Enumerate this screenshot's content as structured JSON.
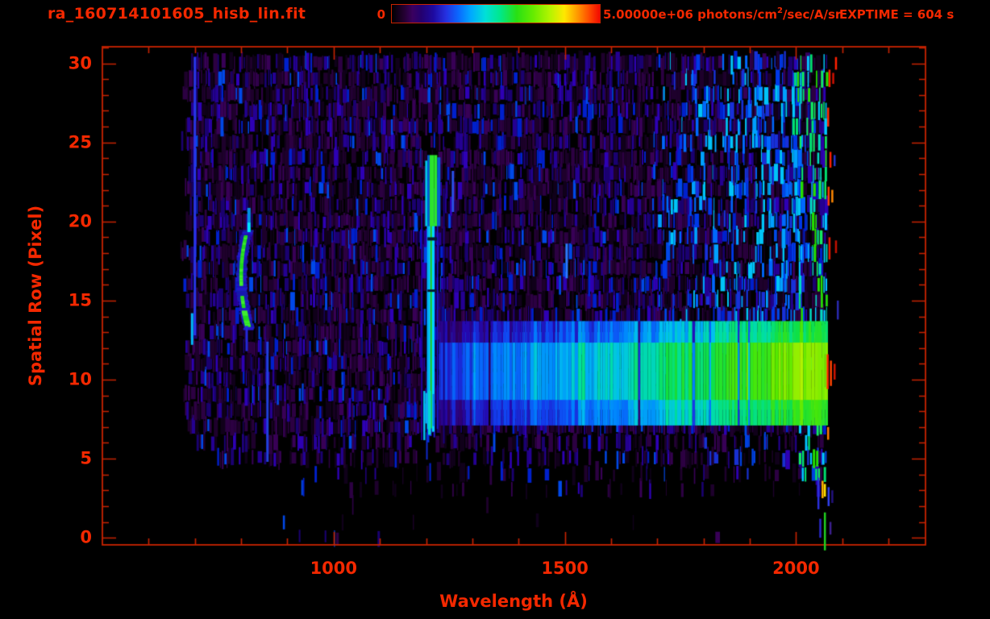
{
  "header": {
    "title": "ra_160714101605_hisb_lin.fit",
    "colorbar": {
      "min_label": "0",
      "max_value": "5.00000e+06",
      "unit_pre": " photons/cm",
      "unit_sup": "2",
      "unit_post": "/sec/A/sr"
    },
    "exptime_label": "EXPTIME = 604 s"
  },
  "colors": {
    "background": "#000000",
    "text_red": "#f32800",
    "axis_red": "#c82300",
    "colormap_stops": [
      "#000000 0%",
      "#240032 6%",
      "#3a0060 10%",
      "#24006e 14%",
      "#1e0aa0 20%",
      "#2530e0 26%",
      "#0a68ff 32%",
      "#00a8ff 38%",
      "#00e0d8 45%",
      "#00e88c 52%",
      "#28e014 60%",
      "#66ec00 68%",
      "#b4f400 76%",
      "#ffe800 83%",
      "#ff9c00 89%",
      "#ff4a00 95%",
      "#f20800 100%"
    ]
  },
  "chart_data": {
    "type": "heatmap",
    "title": "ra_160714101605_hisb_lin.fit",
    "xlabel": "Wavelength (Å)",
    "ylabel": "Spatial Row (Pixel)",
    "xlim": [
      500,
      2280
    ],
    "ylim": [
      -0.45,
      31.05
    ],
    "x_major_ticks": [
      1000,
      1500,
      2000
    ],
    "x_minor_tick_step": 100,
    "x_minor_tick_range": [
      600,
      2200
    ],
    "y_major_ticks": [
      0,
      5,
      10,
      15,
      20,
      25,
      30
    ],
    "y_minor_tick_step": 1,
    "colorbar": {
      "min": 0,
      "max": 5000000,
      "units": "photons/cm^2/sec/A/sr"
    },
    "exposure_time_s": 604,
    "data_wavelength_range": [
      668,
      2072
    ],
    "features": [
      {
        "name": "lyman-alpha-emission-line",
        "type": "vertical-line",
        "wavelength_center": 1208,
        "wavelength_halo": [
          1186,
          1246
        ],
        "rows": [
          5,
          24.3
        ],
        "bright_blob_rows": [
          19.8,
          24.2
        ],
        "narrow_core_rows": [
          7.4,
          19.6
        ],
        "cyan_blob_rows": [
          6.3,
          9
        ]
      },
      {
        "name": "continuum-band",
        "type": "horizontal-band",
        "rows": [
          7.6,
          13.2
        ],
        "wavelength": [
          1228,
          2068
        ],
        "color_ramp": "blue-cyan-green-yellow",
        "peak_rows": [
          8.6,
          12.5
        ]
      },
      {
        "name": "arc-feature",
        "type": "curved-line",
        "wavelength": [
          795,
          826
        ],
        "rows": [
          13.3,
          19.4
        ],
        "green_segments": [
          [
            16.0,
            19.1
          ],
          [
            14.6,
            15.3
          ],
          [
            13.4,
            14.3
          ]
        ]
      },
      {
        "name": "detector-right-edge",
        "type": "bright-edge",
        "wavelength": [
          1992,
          2066
        ],
        "rows": [
          4,
          30.5
        ]
      },
      {
        "name": "upper-right-blue-enhancement",
        "rows": [
          13,
          30.5
        ],
        "wavelength": [
          1700,
          2012
        ]
      },
      {
        "name": "blue-streaks",
        "streaks": [
          {
            "l": 700,
            "rows": [
              12.8,
              30.4
            ],
            "c": "#2836e8"
          },
          {
            "l": 694,
            "rows": [
              12.2,
              14.2
            ],
            "c": "#00b8f8"
          },
          {
            "l": 857,
            "rows": [
              4.8,
              12.4
            ],
            "c": "#2040dd"
          },
          {
            "l": 812,
            "rows": [
              11.8,
              13.4
            ],
            "c": "#2228d8"
          },
          {
            "l": 1504,
            "rows": [
              16.4,
              18.6
            ],
            "c": "#2a7cff"
          },
          {
            "l": 1258,
            "rows": [
              20.6,
              23.2
            ],
            "c": "#2a50e8"
          }
        ]
      },
      {
        "name": "edge-sparks",
        "sparks": [
          {
            "l": 2072,
            "r": [
              28.5,
              29.6
            ],
            "c": "#ff1e00"
          },
          {
            "l": 2080,
            "r": [
              28.7,
              29.4
            ],
            "c": "#d01000"
          },
          {
            "l": 2086,
            "r": [
              29.6,
              30.4
            ],
            "c": "#ff2000"
          },
          {
            "l": 2069,
            "r": [
              26.0,
              27.2
            ],
            "c": "#ff2a00"
          },
          {
            "l": 2074,
            "r": [
              23.4,
              24.4
            ],
            "c": "#ff2000"
          },
          {
            "l": 2083,
            "r": [
              23.5,
              24.2
            ],
            "c": "#2233cc"
          },
          {
            "l": 2070,
            "r": [
              21.0,
              22.2
            ],
            "c": "#ff3c00"
          },
          {
            "l": 2078,
            "r": [
              21.2,
              22.0
            ],
            "c": "#ff8800"
          },
          {
            "l": 2072,
            "r": [
              17.6,
              19.0
            ],
            "c": "#e81800"
          },
          {
            "l": 2086,
            "r": [
              18.0,
              18.8
            ],
            "c": "#c01000"
          },
          {
            "l": 2090,
            "r": [
              13.8,
              15.0
            ],
            "c": "#2a2ab0"
          },
          {
            "l": 2068,
            "r": [
              9.4,
              11.6
            ],
            "c": "#ff2400"
          },
          {
            "l": 2075,
            "r": [
              9.6,
              11.2
            ],
            "c": "#ff4400"
          },
          {
            "l": 2083,
            "r": [
              10.0,
              11.0
            ],
            "c": "#cc1400"
          },
          {
            "l": 2069,
            "r": [
              6.2,
              7.0
            ],
            "c": "#ff7a00"
          },
          {
            "l": 2057,
            "r": [
              2.5,
              3.6
            ],
            "c": "#ffb400"
          },
          {
            "l": 2062,
            "r": [
              2.6,
              3.4
            ],
            "c": "#ffe000"
          },
          {
            "l": 2048,
            "r": [
              1.8,
              3.8
            ],
            "c": "#2a30dd"
          },
          {
            "l": 2070,
            "r": [
              2.0,
              3.2
            ],
            "c": "#3040ee"
          },
          {
            "l": 2078,
            "r": [
              2.2,
              3.0
            ],
            "c": "#23127f"
          },
          {
            "l": 2062,
            "r": [
              -0.8,
              1.6
            ],
            "c": "#20d020"
          },
          {
            "l": 2052,
            "r": [
              0.0,
              1.2
            ],
            "c": "#2828c8"
          },
          {
            "l": 2074,
            "r": [
              0.2,
              1.0
            ],
            "c": "#3c2090"
          }
        ]
      }
    ],
    "noise": {
      "row_density": [
        [
          0,
          2,
          0.03
        ],
        [
          3,
          3,
          0.1
        ],
        [
          4,
          4,
          0.22
        ],
        [
          5,
          6,
          0.55
        ],
        [
          7,
          30,
          0.88
        ]
      ],
      "left_start_wavelength": [
        [
          0,
          2,
          820
        ],
        [
          3,
          4,
          880
        ],
        [
          5,
          5,
          730
        ],
        [
          6,
          6,
          700
        ],
        [
          7,
          30,
          668
        ]
      ]
    }
  }
}
